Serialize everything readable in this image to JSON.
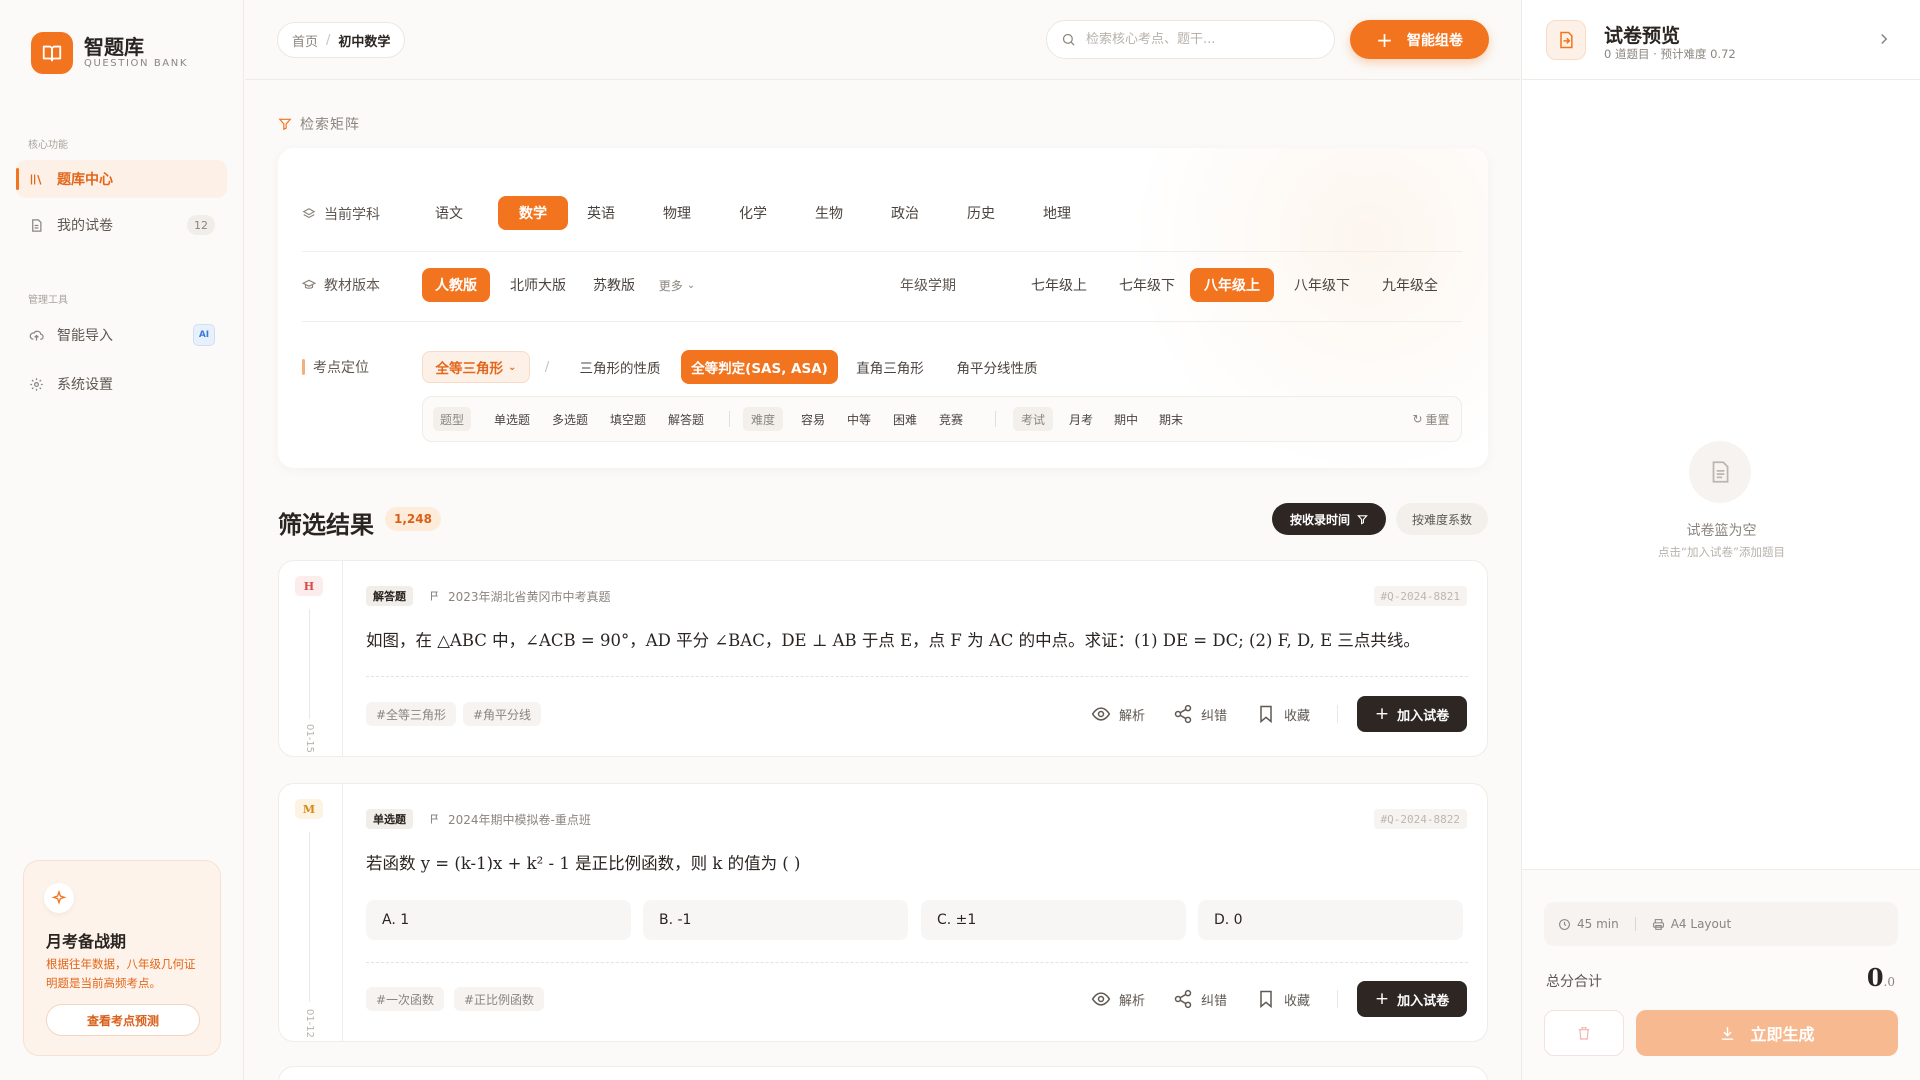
{
  "brand": {
    "name": "智题库",
    "subtitle": "QUESTION BANK"
  },
  "sidebar": {
    "group_core": "核心功能",
    "group_manage": "管理工具",
    "items": [
      {
        "label": "题库中心",
        "icon": "library-icon",
        "active": true
      },
      {
        "label": "我的试卷",
        "icon": "document-icon",
        "badge": "12"
      },
      {
        "label": "智能导入",
        "icon": "cloud-upload-icon",
        "badge": "AI"
      },
      {
        "label": "系统设置",
        "icon": "gear-icon"
      }
    ],
    "promo": {
      "title": "月考备战期",
      "text": "根据往年数据，八年级几何证明题是当前高频考点。",
      "button": "查看考点预测"
    }
  },
  "header": {
    "breadcrumb": [
      "首页",
      "初中数学"
    ],
    "search_placeholder": "检索核心考点、题干...",
    "smart_button": "智能组卷"
  },
  "filters": {
    "section_title": "检索矩阵",
    "subject_label": "当前学科",
    "subjects": [
      "语文",
      "数学",
      "英语",
      "物理",
      "化学",
      "生物",
      "政治",
      "历史",
      "地理"
    ],
    "subject_active": "数学",
    "edition_label": "教材版本",
    "editions": [
      "人教版",
      "北师大版",
      "苏教版"
    ],
    "edition_active": "人教版",
    "edition_more": "更多",
    "grade_label": "年级学期",
    "grades": [
      "七年级上",
      "七年级下",
      "八年级上",
      "八年级下",
      "九年级全"
    ],
    "grade_active": "八年级上",
    "kp_label": "考点定位",
    "kp_parent": "全等三角形",
    "kp_sep": "/",
    "kp_items": [
      "三角形的性质",
      "全等判定(SAS, ASA)",
      "直角三角形",
      "角平分线性质"
    ],
    "kp_active": "全等判定(SAS, ASA)",
    "sub": {
      "type_head": "题型",
      "types": [
        "单选题",
        "多选题",
        "填空题",
        "解答题"
      ],
      "diff_head": "难度",
      "diffs": [
        "容易",
        "中等",
        "困难",
        "竞赛"
      ],
      "exam_head": "考试",
      "exams": [
        "月考",
        "期中",
        "期末"
      ],
      "reset": "重置"
    }
  },
  "results": {
    "title": "筛选结果",
    "count": "1,248",
    "sort_time": "按收录时间",
    "sort_diff": "按难度系数",
    "questions": [
      {
        "level": "H",
        "date": "01-15",
        "type": "解答题",
        "source": "2023年湖北省黄冈市中考真题",
        "id": "#Q-2024-8821",
        "text": "如图，在 △ABC 中，∠ACB = 90°，AD 平分 ∠BAC，DE ⊥ AB 于点 E，点 F 为 AC 的中点。求证：(1) DE = DC; (2) F, D, E 三点共线。",
        "tags": [
          "#全等三角形",
          "#角平分线"
        ],
        "actions": [
          "解析",
          "纠错",
          "收藏"
        ],
        "add": "加入试卷"
      },
      {
        "level": "M",
        "date": "01-12",
        "type": "单选题",
        "source": "2024年期中模拟卷-重点班",
        "id": "#Q-2024-8822",
        "text": "若函数 y = (k-1)x + k² - 1 是正比例函数，则 k 的值为 ( )",
        "options": [
          "A. 1",
          "B. -1",
          "C. ±1",
          "D. 0"
        ],
        "tags": [
          "#一次函数",
          "#正比例函数"
        ],
        "actions": [
          "解析",
          "纠错",
          "收藏"
        ],
        "add": "加入试卷"
      }
    ]
  },
  "preview": {
    "title": "试卷预览",
    "subtitle": "0 道题目 · 预计难度 0.72",
    "empty_title": "试卷篮为空",
    "empty_sub": "点击“加入试卷”添加题目",
    "duration": "45 min",
    "layout": "A4 Layout",
    "total_label": "总分合计",
    "total_int": "0",
    "total_dec": ".0",
    "generate": "立即生成"
  },
  "colors": {
    "accent": "#f2741f",
    "dark": "#2d2623",
    "bg": "#fbfaf8"
  }
}
